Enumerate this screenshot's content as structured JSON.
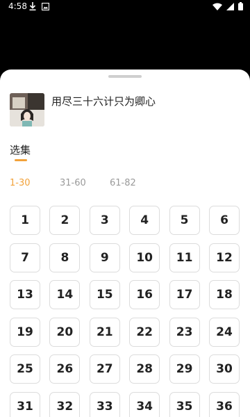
{
  "status_bar": {
    "time": "4:58",
    "left_icons": [
      "download-icon",
      "image-icon"
    ],
    "right_icons": [
      "wifi-icon",
      "signal-icon",
      "battery-icon"
    ]
  },
  "drama": {
    "title": "用尽三十六计只为卿心",
    "thumbnail": "drama-thumbnail"
  },
  "section": {
    "label": "选集"
  },
  "range_tabs": [
    {
      "label": "1-30",
      "active": true
    },
    {
      "label": "31-60",
      "active": false
    },
    {
      "label": "61-82",
      "active": false
    }
  ],
  "episodes": [
    "1",
    "2",
    "3",
    "4",
    "5",
    "6",
    "7",
    "8",
    "9",
    "10",
    "11",
    "12",
    "13",
    "14",
    "15",
    "16",
    "17",
    "18",
    "19",
    "20",
    "21",
    "22",
    "23",
    "24",
    "25",
    "26",
    "27",
    "28",
    "29",
    "30",
    "31",
    "32",
    "33",
    "34",
    "35",
    "36"
  ],
  "colors": {
    "accent": "#f2a23a",
    "text": "#222222",
    "muted": "#9a9a9a",
    "border": "#dcdcdc"
  }
}
